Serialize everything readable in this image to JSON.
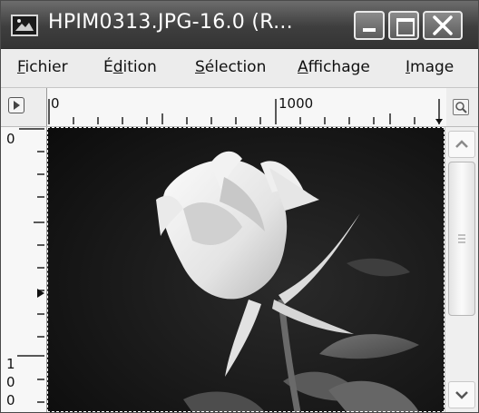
{
  "window": {
    "title": "HPIM0313.JPG-16.0 (R..."
  },
  "icons": {
    "app": "image-document-icon",
    "minimize": "minimize-icon",
    "maximize": "maximize-icon",
    "close": "close-icon",
    "navigate": "navigate-arrow-icon",
    "zoom": "zoom-icon",
    "scroll_up": "chevron-up-icon",
    "scroll_down": "chevron-down-icon"
  },
  "menu": {
    "fichier": "ichier",
    "fichier_key": "F",
    "edition_pre": "É",
    "edition_key": "d",
    "edition_post": "ition",
    "selection_key": "S",
    "selection": "élection",
    "affichage_key": "A",
    "affichage": "ffichage",
    "image_key": "I",
    "image": "mage"
  },
  "ruler": {
    "h_start": "0",
    "h_mid": "1000",
    "v_top": "0",
    "v_bottom_1": "1",
    "v_bottom_2": "0",
    "v_bottom_3": "0"
  },
  "canvas": {
    "content": "Black and white photograph of a rose"
  }
}
